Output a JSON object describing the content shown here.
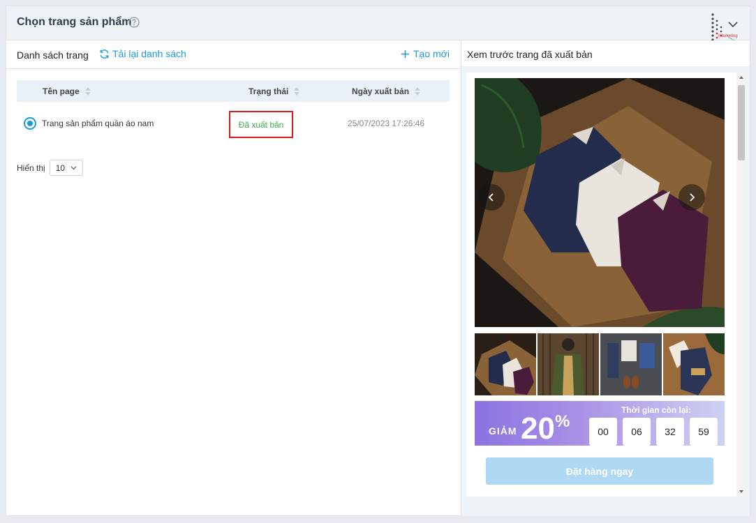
{
  "header": {
    "title": "Chọn trang sản phẩm",
    "logo_text": "iMarketing"
  },
  "left": {
    "list_title": "Danh sách trang",
    "reload_label": "Tải lại danh sách",
    "create_label": "Tạo mới",
    "columns": [
      "Tên page",
      "Trạng thái",
      "Ngày xuất bản"
    ],
    "rows": [
      {
        "name": "Trang sản phẩm quần áo nam",
        "status": "Đã xuất bản",
        "date": "25/07/2023 17:26:46",
        "selected": true
      }
    ],
    "pager": {
      "label": "Hiển thị",
      "page_size": "10"
    }
  },
  "right": {
    "preview_title": "Xem trước trang đã xuất bản",
    "promo": {
      "label": "GIẢM",
      "value": "20",
      "unit": "%",
      "countdown_label": "Thời gian còn lại:",
      "countdown": [
        "00",
        "06",
        "32",
        "59"
      ]
    },
    "order_button": "Đặt hàng ngay"
  },
  "colors": {
    "accent": "#1a9ae0",
    "status_green": "#3bb04a",
    "highlight_red": "#d21d1d",
    "order_button": "#aed8f3"
  }
}
